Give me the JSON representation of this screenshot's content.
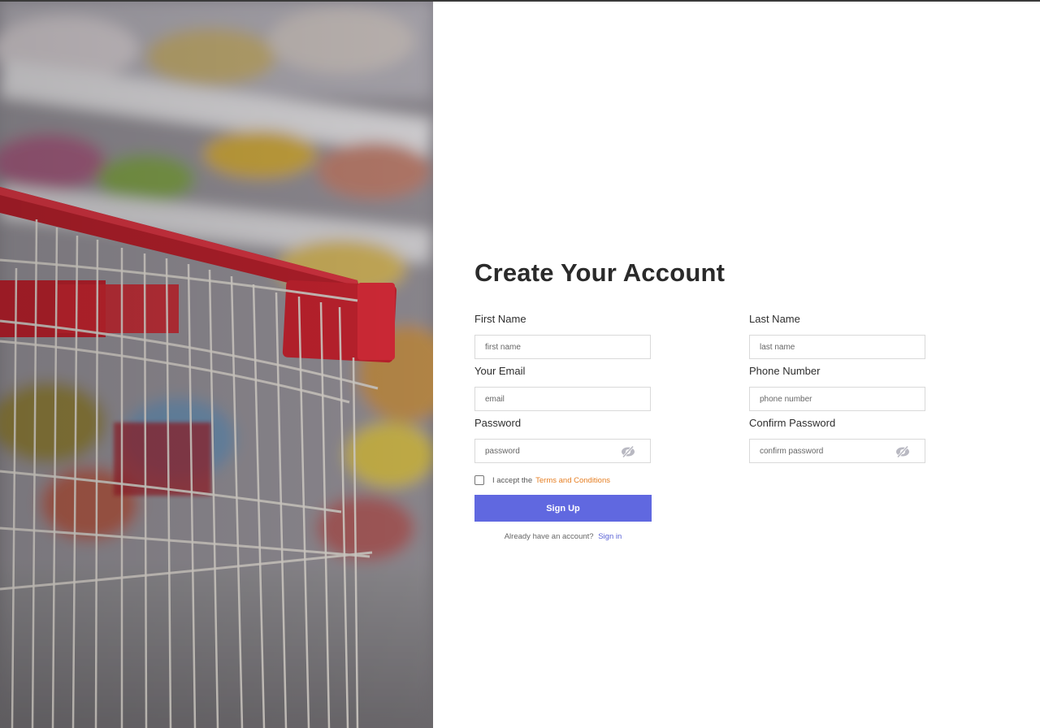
{
  "form": {
    "title": "Create Your Account",
    "first_name": {
      "label": "First Name",
      "placeholder": "first name"
    },
    "last_name": {
      "label": "Last Name",
      "placeholder": "last name"
    },
    "email": {
      "label": "Your Email",
      "placeholder": "email"
    },
    "phone": {
      "label": "Phone Number",
      "placeholder": "phone number"
    },
    "password": {
      "label": "Password",
      "placeholder": "password",
      "toggle_icon": "eye-slash-icon"
    },
    "confirm_password": {
      "label": "Confirm Password",
      "placeholder": "confirm password",
      "toggle_icon": "eye-slash-icon"
    },
    "terms": {
      "prefix": "I accept the",
      "link": "Terms and Conditions",
      "checked": false
    },
    "submit_label": "Sign Up",
    "signin": {
      "prompt": "Already have an account?",
      "link": "Sign in"
    }
  },
  "colors": {
    "primary": "#6068e0",
    "terms_link": "#e67e22",
    "signin_link": "#5a62d6"
  },
  "hero_image": "shopping-cart-in-supermarket-aisle"
}
